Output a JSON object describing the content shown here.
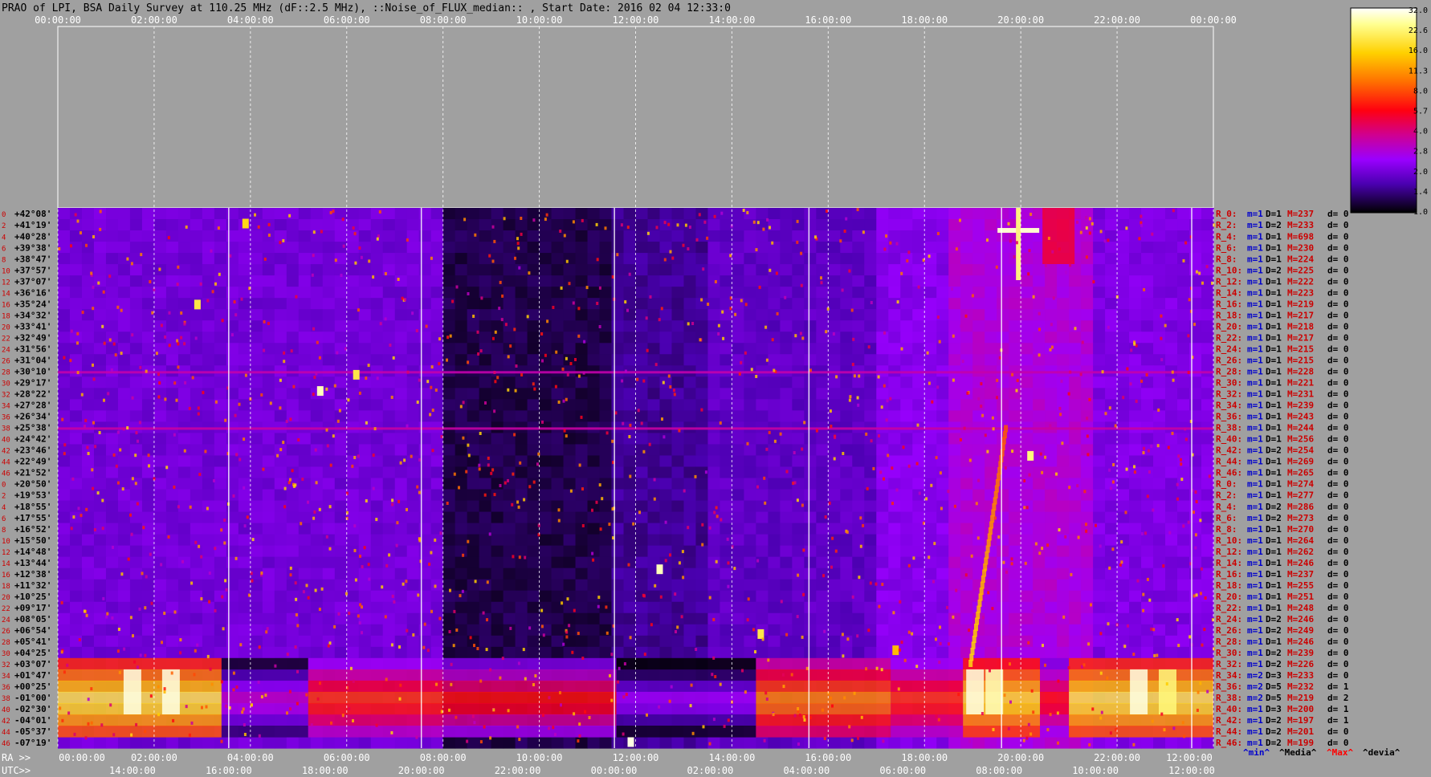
{
  "title": "PRAO of LPI, BSA Daily Survey at 110.25 MHz (dF::2.5 MHz), ::Noise_of_FLUX_median:: , Start Date: 2016 02 04 12:33:0",
  "top_axis_labels": [
    "00:00:00",
    "02:00:00",
    "04:00:00",
    "06:00:00",
    "08:00:00",
    "10:00:00",
    "12:00:00",
    "14:00:00",
    "16:00:00",
    "18:00:00",
    "20:00:00",
    "22:00:00",
    "00:00:00"
  ],
  "ra_prefix": "RA >>",
  "ra_labels": [
    "00:00:00",
    "02:00:00",
    "04:00:00",
    "06:00:00",
    "08:00:00",
    "10:00:00",
    "12:00:00",
    "14:00:00",
    "16:00:00",
    "18:00:00",
    "20:00:00",
    "22:00:00",
    "12:00:00"
  ],
  "utc_prefix": "UTC>>",
  "utc_labels": [
    "14:00:00",
    "16:00:00",
    "18:00:00",
    "20:00:00",
    "22:00:00",
    "00:00:00",
    "02:00:00",
    "04:00:00",
    "06:00:00",
    "08:00:00",
    "10:00:00",
    "12:00:00"
  ],
  "colorbar_ticks": [
    "32.0",
    "22.6",
    "16.0",
    "11.3",
    "8.0",
    "5.7",
    "4.0",
    "2.8",
    "2.0",
    "1.4",
    "1.0"
  ],
  "footer_legend": [
    {
      "text": "^min^",
      "color": "#0000cc"
    },
    {
      "text": "^Media^",
      "color": "#000000"
    },
    {
      "text": "^Max^",
      "color": "#ff0000"
    },
    {
      "text": "^devia^",
      "color": "#000000"
    }
  ],
  "colors": {
    "background": "#a0a0a0",
    "dec_label": "#000000",
    "index_label": "#cc0000",
    "beam_label": "#cc0000",
    "stat_m": "#0000cc",
    "stat_D": "#000000",
    "stat_M": "#cc0000"
  },
  "chart_data": {
    "type": "heatmap",
    "title": "PRAO of LPI, BSA Daily Survey at 110.25 MHz (dF::2.5 MHz), ::Noise_of_FLUX_median:: , Start Date: 2016 02 04 12:33:0",
    "x_axis": "RA / UTC (hours)",
    "x_range": [
      0,
      24
    ],
    "color_scale": "log",
    "color_range": [
      1.0,
      32.0
    ],
    "rows": [
      {
        "idx": "0",
        "dec": "+42°08'",
        "beam": "R_0:",
        "m": "m=1",
        "D": "D=1",
        "M": "M=237",
        "d": "d= 0"
      },
      {
        "idx": "2",
        "dec": "+41°19'",
        "beam": "R_2:",
        "m": "m=1",
        "D": "D=2",
        "M": "M=233",
        "d": "d= 0"
      },
      {
        "idx": "4",
        "dec": "+40°28'",
        "beam": "R_4:",
        "m": "m=1",
        "D": "D=1",
        "M": "M=698",
        "d": "d= 0"
      },
      {
        "idx": "6",
        "dec": "+39°38'",
        "beam": "R_6:",
        "m": "m=1",
        "D": "D=1",
        "M": "M=230",
        "d": "d= 0"
      },
      {
        "idx": "8",
        "dec": "+38°47'",
        "beam": "R_8:",
        "m": "m=1",
        "D": "D=1",
        "M": "M=224",
        "d": "d= 0"
      },
      {
        "idx": "10",
        "dec": "+37°57'",
        "beam": "R_10:",
        "m": "m=1",
        "D": "D=2",
        "M": "M=225",
        "d": "d= 0"
      },
      {
        "idx": "12",
        "dec": "+37°07'",
        "beam": "R_12:",
        "m": "m=1",
        "D": "D=1",
        "M": "M=222",
        "d": "d= 0"
      },
      {
        "idx": "14",
        "dec": "+36°16'",
        "beam": "R_14:",
        "m": "m=1",
        "D": "D=1",
        "M": "M=223",
        "d": "d= 0"
      },
      {
        "idx": "16",
        "dec": "+35°24'",
        "beam": "R_16:",
        "m": "m=1",
        "D": "D=1",
        "M": "M=219",
        "d": "d= 0"
      },
      {
        "idx": "18",
        "dec": "+34°32'",
        "beam": "R_18:",
        "m": "m=1",
        "D": "D=1",
        "M": "M=217",
        "d": "d= 0"
      },
      {
        "idx": "20",
        "dec": "+33°41'",
        "beam": "R_20:",
        "m": "m=1",
        "D": "D=1",
        "M": "M=218",
        "d": "d= 0"
      },
      {
        "idx": "22",
        "dec": "+32°49'",
        "beam": "R_22:",
        "m": "m=1",
        "D": "D=1",
        "M": "M=217",
        "d": "d= 0"
      },
      {
        "idx": "24",
        "dec": "+31°56'",
        "beam": "R_24:",
        "m": "m=1",
        "D": "D=1",
        "M": "M=215",
        "d": "d= 0"
      },
      {
        "idx": "26",
        "dec": "+31°04'",
        "beam": "R_26:",
        "m": "m=1",
        "D": "D=1",
        "M": "M=215",
        "d": "d= 0"
      },
      {
        "idx": "28",
        "dec": "+30°10'",
        "beam": "R_28:",
        "m": "m=1",
        "D": "D=1",
        "M": "M=228",
        "d": "d= 0"
      },
      {
        "idx": "30",
        "dec": "+29°17'",
        "beam": "R_30:",
        "m": "m=1",
        "D": "D=1",
        "M": "M=221",
        "d": "d= 0"
      },
      {
        "idx": "32",
        "dec": "+28°22'",
        "beam": "R_32:",
        "m": "m=1",
        "D": "D=1",
        "M": "M=231",
        "d": "d= 0"
      },
      {
        "idx": "34",
        "dec": "+27°28'",
        "beam": "R_34:",
        "m": "m=1",
        "D": "D=1",
        "M": "M=239",
        "d": "d= 0"
      },
      {
        "idx": "36",
        "dec": "+26°34'",
        "beam": "R_36:",
        "m": "m=1",
        "D": "D=1",
        "M": "M=243",
        "d": "d= 0"
      },
      {
        "idx": "38",
        "dec": "+25°38'",
        "beam": "R_38:",
        "m": "m=1",
        "D": "D=1",
        "M": "M=244",
        "d": "d= 0"
      },
      {
        "idx": "40",
        "dec": "+24°42'",
        "beam": "R_40:",
        "m": "m=1",
        "D": "D=1",
        "M": "M=256",
        "d": "d= 0"
      },
      {
        "idx": "42",
        "dec": "+23°46'",
        "beam": "R_42:",
        "m": "m=1",
        "D": "D=2",
        "M": "M=254",
        "d": "d= 0"
      },
      {
        "idx": "44",
        "dec": "+22°49'",
        "beam": "R_44:",
        "m": "m=1",
        "D": "D=1",
        "M": "M=269",
        "d": "d= 0"
      },
      {
        "idx": "46",
        "dec": "+21°52'",
        "beam": "R_46:",
        "m": "m=1",
        "D": "D=1",
        "M": "M=265",
        "d": "d= 0"
      },
      {
        "idx": "0",
        "dec": "+20°50'",
        "beam": "R_0:",
        "m": "m=1",
        "D": "D=1",
        "M": "M=274",
        "d": "d= 0"
      },
      {
        "idx": "2",
        "dec": "+19°53'",
        "beam": "R_2:",
        "m": "m=1",
        "D": "D=1",
        "M": "M=277",
        "d": "d= 0"
      },
      {
        "idx": "4",
        "dec": "+18°55'",
        "beam": "R_4:",
        "m": "m=1",
        "D": "D=2",
        "M": "M=286",
        "d": "d= 0"
      },
      {
        "idx": "6",
        "dec": "+17°55'",
        "beam": "R_6:",
        "m": "m=1",
        "D": "D=2",
        "M": "M=273",
        "d": "d= 0"
      },
      {
        "idx": "8",
        "dec": "+16°52'",
        "beam": "R_8:",
        "m": "m=1",
        "D": "D=1",
        "M": "M=270",
        "d": "d= 0"
      },
      {
        "idx": "10",
        "dec": "+15°50'",
        "beam": "R_10:",
        "m": "m=1",
        "D": "D=1",
        "M": "M=264",
        "d": "d= 0"
      },
      {
        "idx": "12",
        "dec": "+14°48'",
        "beam": "R_12:",
        "m": "m=1",
        "D": "D=1",
        "M": "M=262",
        "d": "d= 0"
      },
      {
        "idx": "14",
        "dec": "+13°44'",
        "beam": "R_14:",
        "m": "m=1",
        "D": "D=1",
        "M": "M=246",
        "d": "d= 0"
      },
      {
        "idx": "16",
        "dec": "+12°38'",
        "beam": "R_16:",
        "m": "m=1",
        "D": "D=1",
        "M": "M=237",
        "d": "d= 0"
      },
      {
        "idx": "18",
        "dec": "+11°32'",
        "beam": "R_18:",
        "m": "m=1",
        "D": "D=1",
        "M": "M=255",
        "d": "d= 0"
      },
      {
        "idx": "20",
        "dec": "+10°25'",
        "beam": "R_20:",
        "m": "m=1",
        "D": "D=1",
        "M": "M=251",
        "d": "d= 0"
      },
      {
        "idx": "22",
        "dec": "+09°17'",
        "beam": "R_22:",
        "m": "m=1",
        "D": "D=1",
        "M": "M=248",
        "d": "d= 0"
      },
      {
        "idx": "24",
        "dec": "+08°05'",
        "beam": "R_24:",
        "m": "m=1",
        "D": "D=2",
        "M": "M=246",
        "d": "d= 0"
      },
      {
        "idx": "26",
        "dec": "+06°54'",
        "beam": "R_26:",
        "m": "m=1",
        "D": "D=2",
        "M": "M=249",
        "d": "d= 0"
      },
      {
        "idx": "28",
        "dec": "+05°41'",
        "beam": "R_28:",
        "m": "m=1",
        "D": "D=1",
        "M": "M=246",
        "d": "d= 0"
      },
      {
        "idx": "30",
        "dec": "+04°25'",
        "beam": "R_30:",
        "m": "m=1",
        "D": "D=2",
        "M": "M=239",
        "d": "d= 0"
      },
      {
        "idx": "32",
        "dec": "+03°07'",
        "beam": "R_32:",
        "m": "m=1",
        "D": "D=2",
        "M": "M=226",
        "d": "d= 0"
      },
      {
        "idx": "34",
        "dec": "+01°47'",
        "beam": "R_34:",
        "m": "m=2",
        "D": "D=3",
        "M": "M=233",
        "d": "d= 0"
      },
      {
        "idx": "36",
        "dec": "+00°25'",
        "beam": "R_36:",
        "m": "m=2",
        "D": "D=5",
        "M": "M=232",
        "d": "d= 1"
      },
      {
        "idx": "38",
        "dec": "-01°00'",
        "beam": "R_38:",
        "m": "m=2",
        "D": "D=5",
        "M": "M=219",
        "d": "d= 2"
      },
      {
        "idx": "40",
        "dec": "-02°30'",
        "beam": "R_40:",
        "m": "m=1",
        "D": "D=3",
        "M": "M=200",
        "d": "d= 1"
      },
      {
        "idx": "42",
        "dec": "-04°01'",
        "beam": "R_42:",
        "m": "m=1",
        "D": "D=2",
        "M": "M=197",
        "d": "d= 1"
      },
      {
        "idx": "44",
        "dec": "-05°37'",
        "beam": "R_44:",
        "m": "m=1",
        "D": "D=2",
        "M": "M=201",
        "d": "d= 0"
      },
      {
        "idx": "46",
        "dec": "-07°19'",
        "beam": "R_46:",
        "m": "m=1",
        "D": "D=2",
        "M": "M=199",
        "d": "d= 0"
      }
    ]
  }
}
